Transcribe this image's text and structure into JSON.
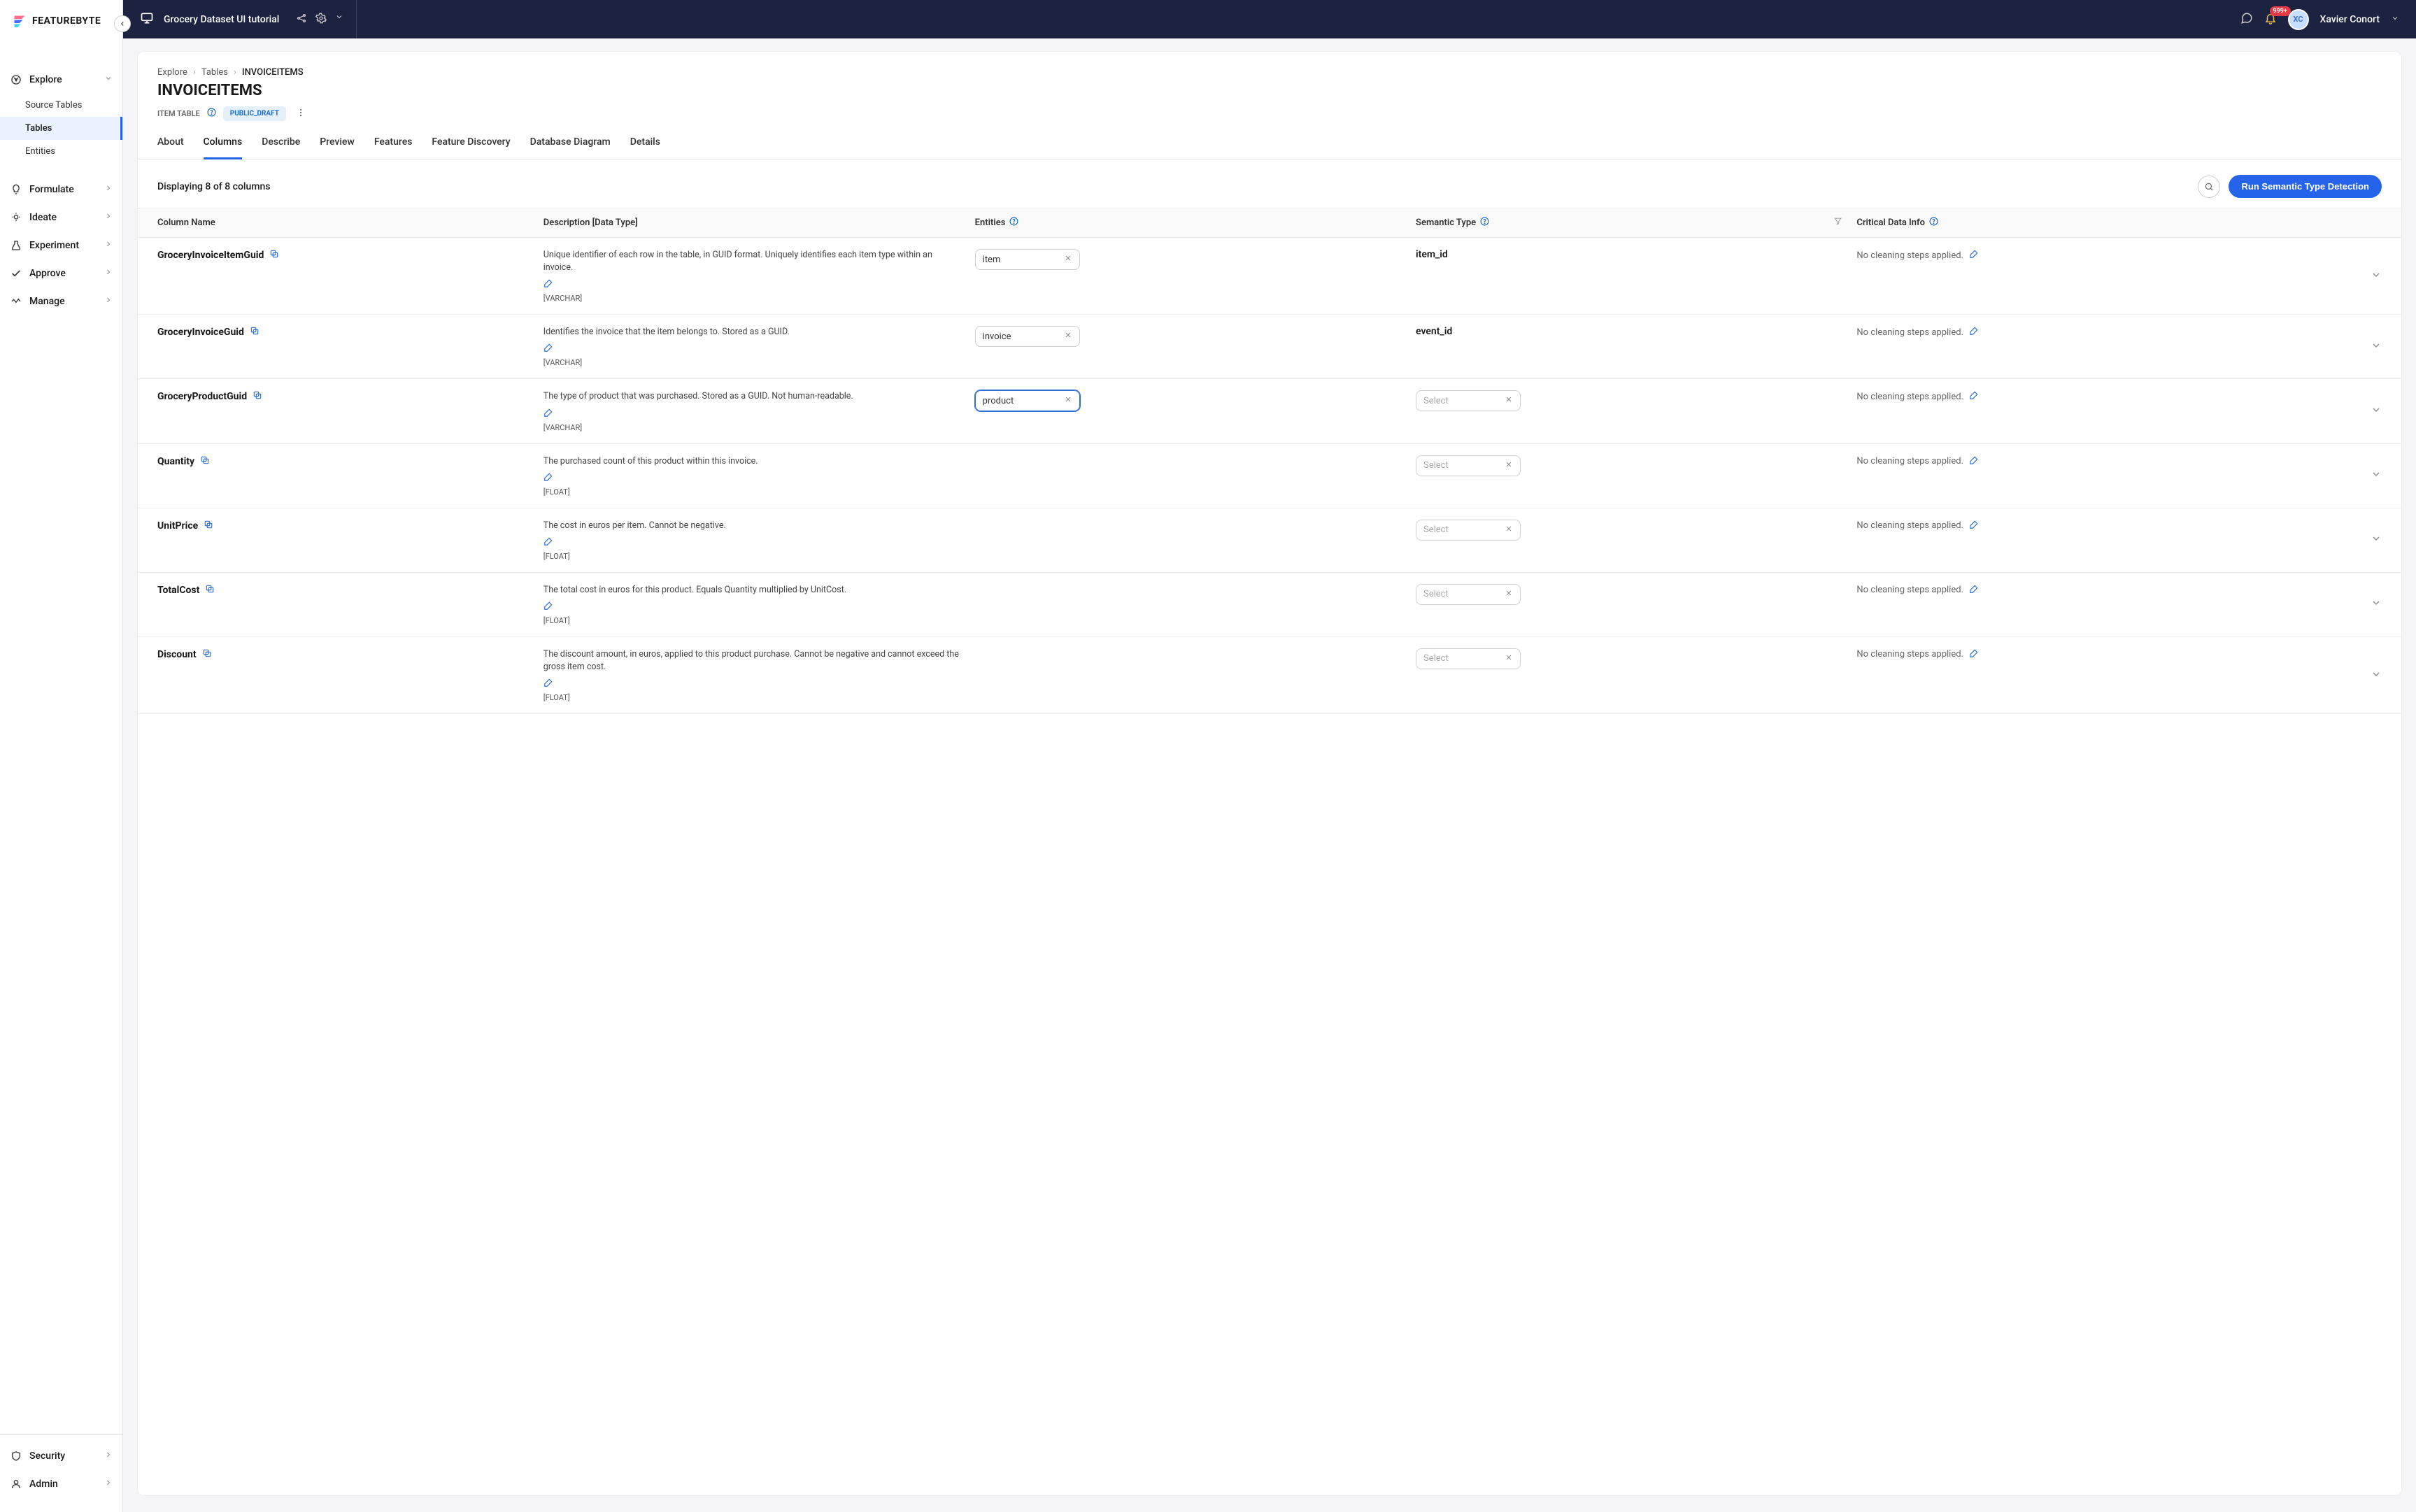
{
  "brand": {
    "name": "FEATUREBYTE"
  },
  "topbar": {
    "project": "Grocery Dataset UI tutorial",
    "user": "Xavier Conort",
    "initials": "XC",
    "notif": "999+"
  },
  "sidebar": {
    "explore": {
      "label": "Explore",
      "items": [
        "Source Tables",
        "Tables",
        "Entities"
      ],
      "active_index": 1
    },
    "formulate": "Formulate",
    "ideate": "Ideate",
    "experiment": "Experiment",
    "approve": "Approve",
    "manage": "Manage",
    "security": "Security",
    "admin": "Admin"
  },
  "breadcrumb": {
    "a": "Explore",
    "b": "Tables",
    "c": "INVOICEITEMS"
  },
  "page": {
    "title": "INVOICEITEMS",
    "type_label": "ITEM TABLE",
    "status": "PUBLIC_DRAFT"
  },
  "tabs": [
    "About",
    "Columns",
    "Describe",
    "Preview",
    "Features",
    "Feature Discovery",
    "Database Diagram",
    "Details"
  ],
  "active_tab_index": 1,
  "toolbar": {
    "count_text": "Displaying 8 of 8 columns",
    "run_btn": "Run Semantic Type Detection"
  },
  "columns": {
    "headers": {
      "name": "Column Name",
      "desc": "Description [Data Type]",
      "entities": "Entities",
      "semantic": "Semantic Type",
      "cdi": "Critical Data Info"
    }
  },
  "select_placeholder": "Select",
  "cdi_empty": "No cleaning steps applied.",
  "rows": [
    {
      "name": "GroceryInvoiceItemGuid",
      "desc": "Unique identifier of each row in the table, in GUID format. Uniquely identifies each item type within an invoice.",
      "dtype": "[VARCHAR]",
      "entity": "item",
      "semantic": "item_id",
      "entity_highlight": false
    },
    {
      "name": "GroceryInvoiceGuid",
      "desc": "Identifies the invoice that the item belongs to. Stored as a GUID.",
      "dtype": "[VARCHAR]",
      "entity": "invoice",
      "semantic": "event_id",
      "entity_highlight": false
    },
    {
      "name": "GroceryProductGuid",
      "desc": "The type of product that was purchased. Stored as a GUID. Not human-readable.",
      "dtype": "[VARCHAR]",
      "entity": "product",
      "semantic": null,
      "entity_highlight": true
    },
    {
      "name": "Quantity",
      "desc": "The purchased count of this product within this invoice.",
      "dtype": "[FLOAT]",
      "entity": null,
      "semantic": null,
      "entity_highlight": false
    },
    {
      "name": "UnitPrice",
      "desc": "The cost in euros per item. Cannot be negative.",
      "dtype": "[FLOAT]",
      "entity": null,
      "semantic": null,
      "entity_highlight": false
    },
    {
      "name": "TotalCost",
      "desc": "The total cost in euros for this product. Equals Quantity multiplied by UnitCost.",
      "dtype": "[FLOAT]",
      "entity": null,
      "semantic": null,
      "entity_highlight": false
    },
    {
      "name": "Discount",
      "desc": "The discount amount, in euros, applied to this product purchase. Cannot be negative and cannot exceed the gross item cost.",
      "dtype": "[FLOAT]",
      "entity": null,
      "semantic": null,
      "entity_highlight": false
    }
  ]
}
